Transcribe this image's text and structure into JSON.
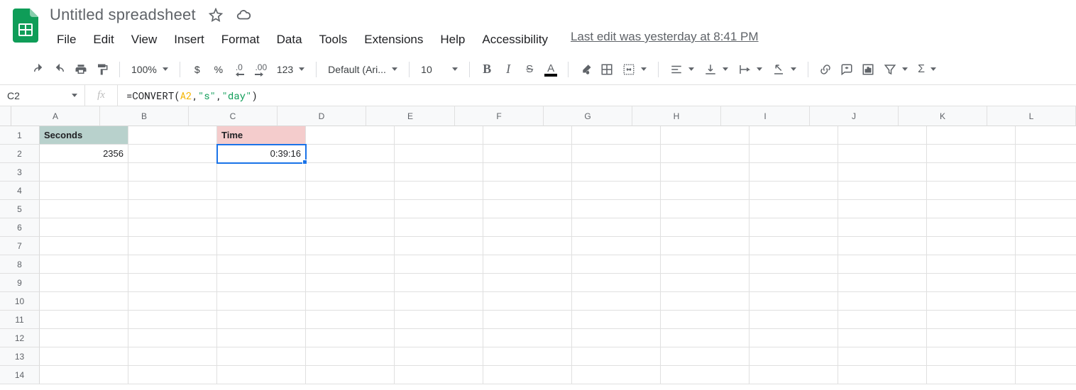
{
  "doc": {
    "title": "Untitled spreadsheet"
  },
  "menubar": {
    "file": "File",
    "edit": "Edit",
    "view": "View",
    "insert": "Insert",
    "format": "Format",
    "data": "Data",
    "tools": "Tools",
    "extensions": "Extensions",
    "help": "Help",
    "accessibility": "Accessibility",
    "last_edit": "Last edit was yesterday at 8:41 PM"
  },
  "toolbar": {
    "zoom": "100%",
    "more_formats": "123",
    "font": "Default (Ari...",
    "font_size": "10",
    "text_color_glyph": "A",
    "decimal_less": ".0",
    "decimal_more": ".00",
    "currency": "$",
    "percent": "%",
    "bold": "B",
    "italic": "I",
    "strike": "S",
    "sigma": "Σ"
  },
  "formula": {
    "cell_ref": "C2",
    "fx_label": "fx",
    "tokens": {
      "eq": "=",
      "fn": "CONVERT",
      "lp": "(",
      "ref": "A2",
      "c1": ", ",
      "s1": "\"s\"",
      "c2": ", ",
      "s2": "\"day\"",
      "rp": ")"
    }
  },
  "grid": {
    "columns": [
      "A",
      "B",
      "C",
      "D",
      "E",
      "F",
      "G",
      "H",
      "I",
      "J",
      "K",
      "L"
    ],
    "row_count": 14,
    "selected": "C2",
    "cells": {
      "A1": "Seconds",
      "C1": "Time",
      "A2": "2356",
      "C2": "0:39:16"
    }
  }
}
